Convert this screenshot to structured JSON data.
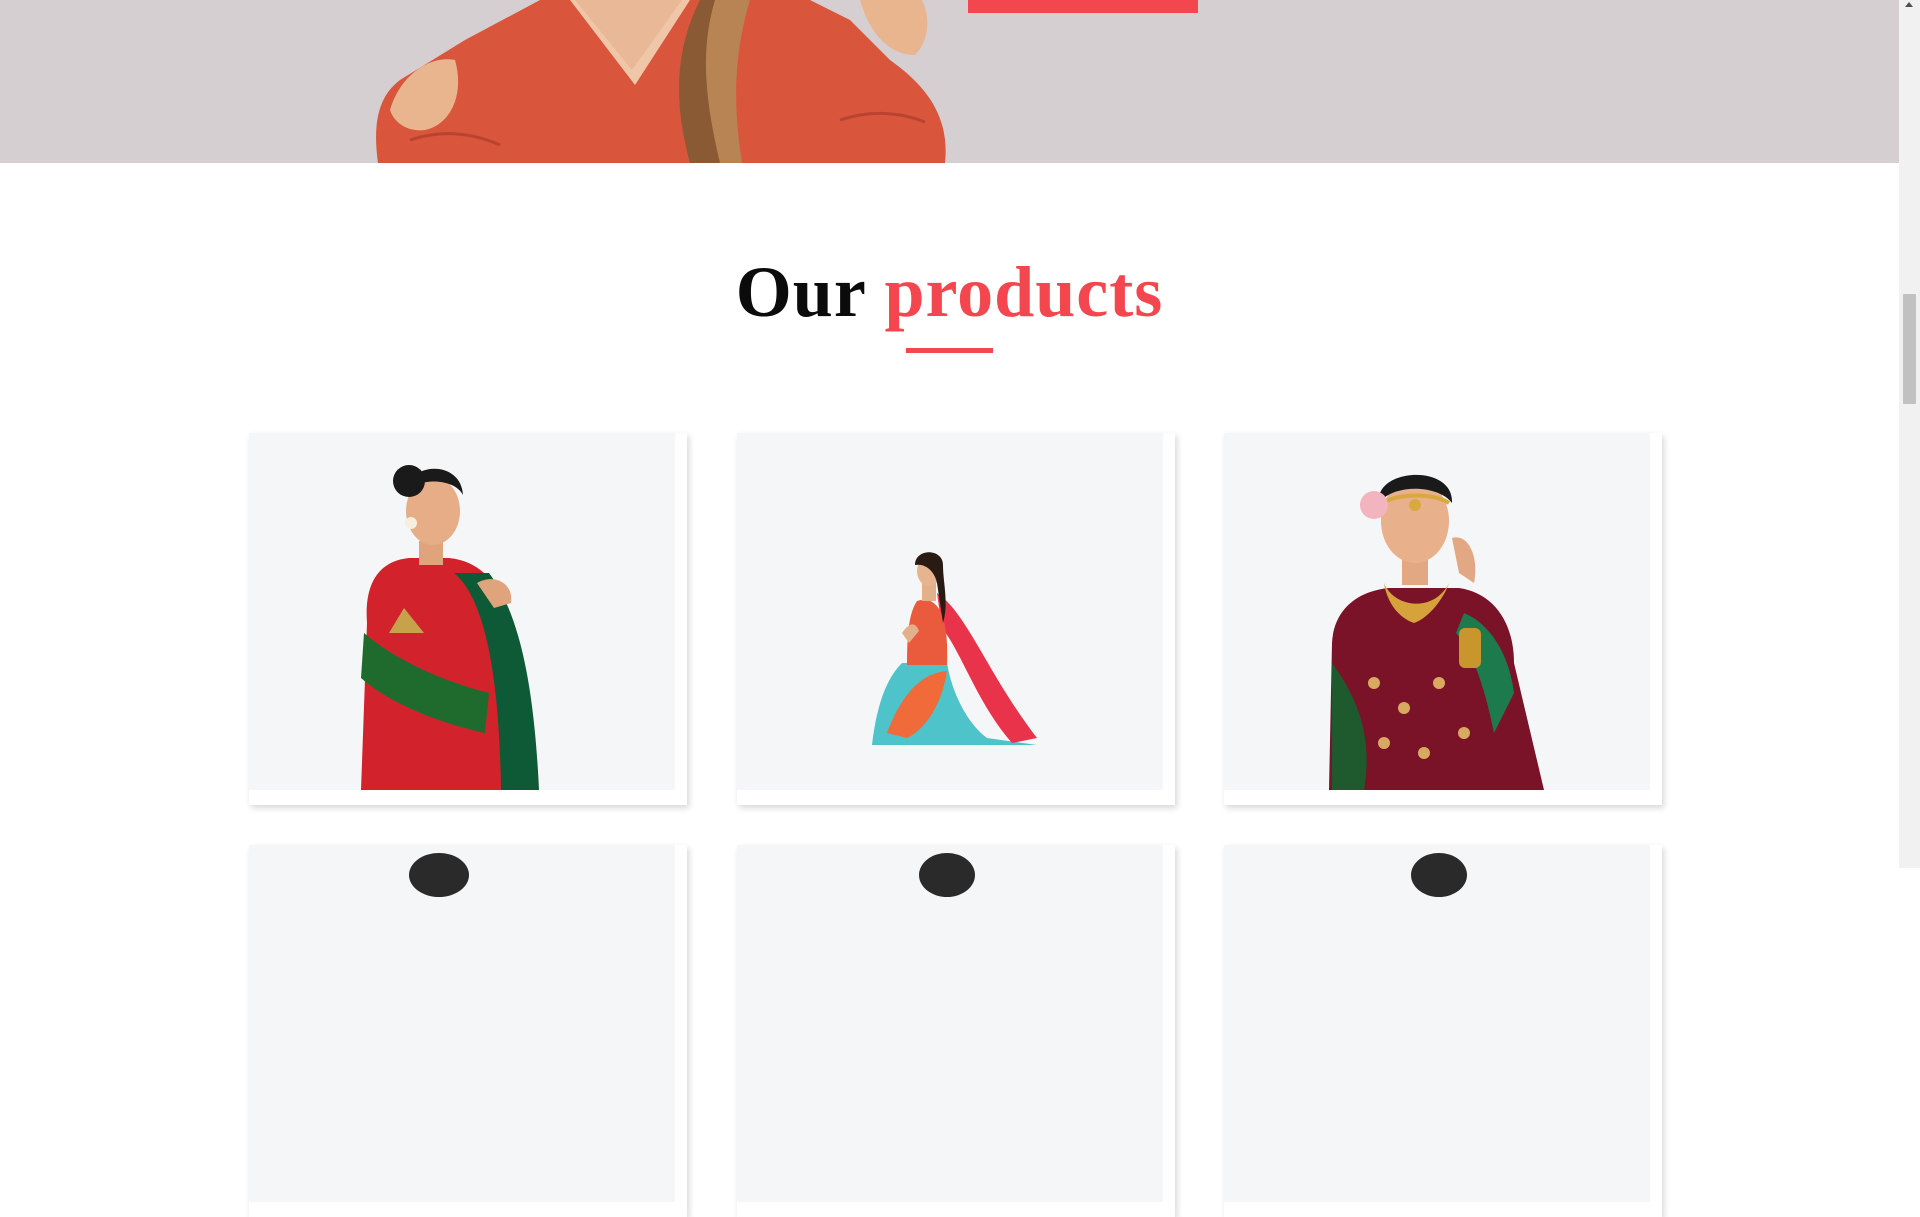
{
  "section": {
    "title_dark": "Our",
    "title_accent": "products"
  },
  "colors": {
    "accent": "#f4464f",
    "hero_background": "#d6cfd2",
    "card_media_background": "#f5f6f8"
  },
  "products": [
    {
      "image": "woman-in-red-green-silk-saree"
    },
    {
      "image": "seated-model-in-red-teal-floral-saree"
    },
    {
      "image": "bride-in-maroon-bandhani-saree-with-jewelry"
    },
    {
      "image": "product-photo"
    },
    {
      "image": "product-photo"
    },
    {
      "image": "product-photo"
    }
  ]
}
